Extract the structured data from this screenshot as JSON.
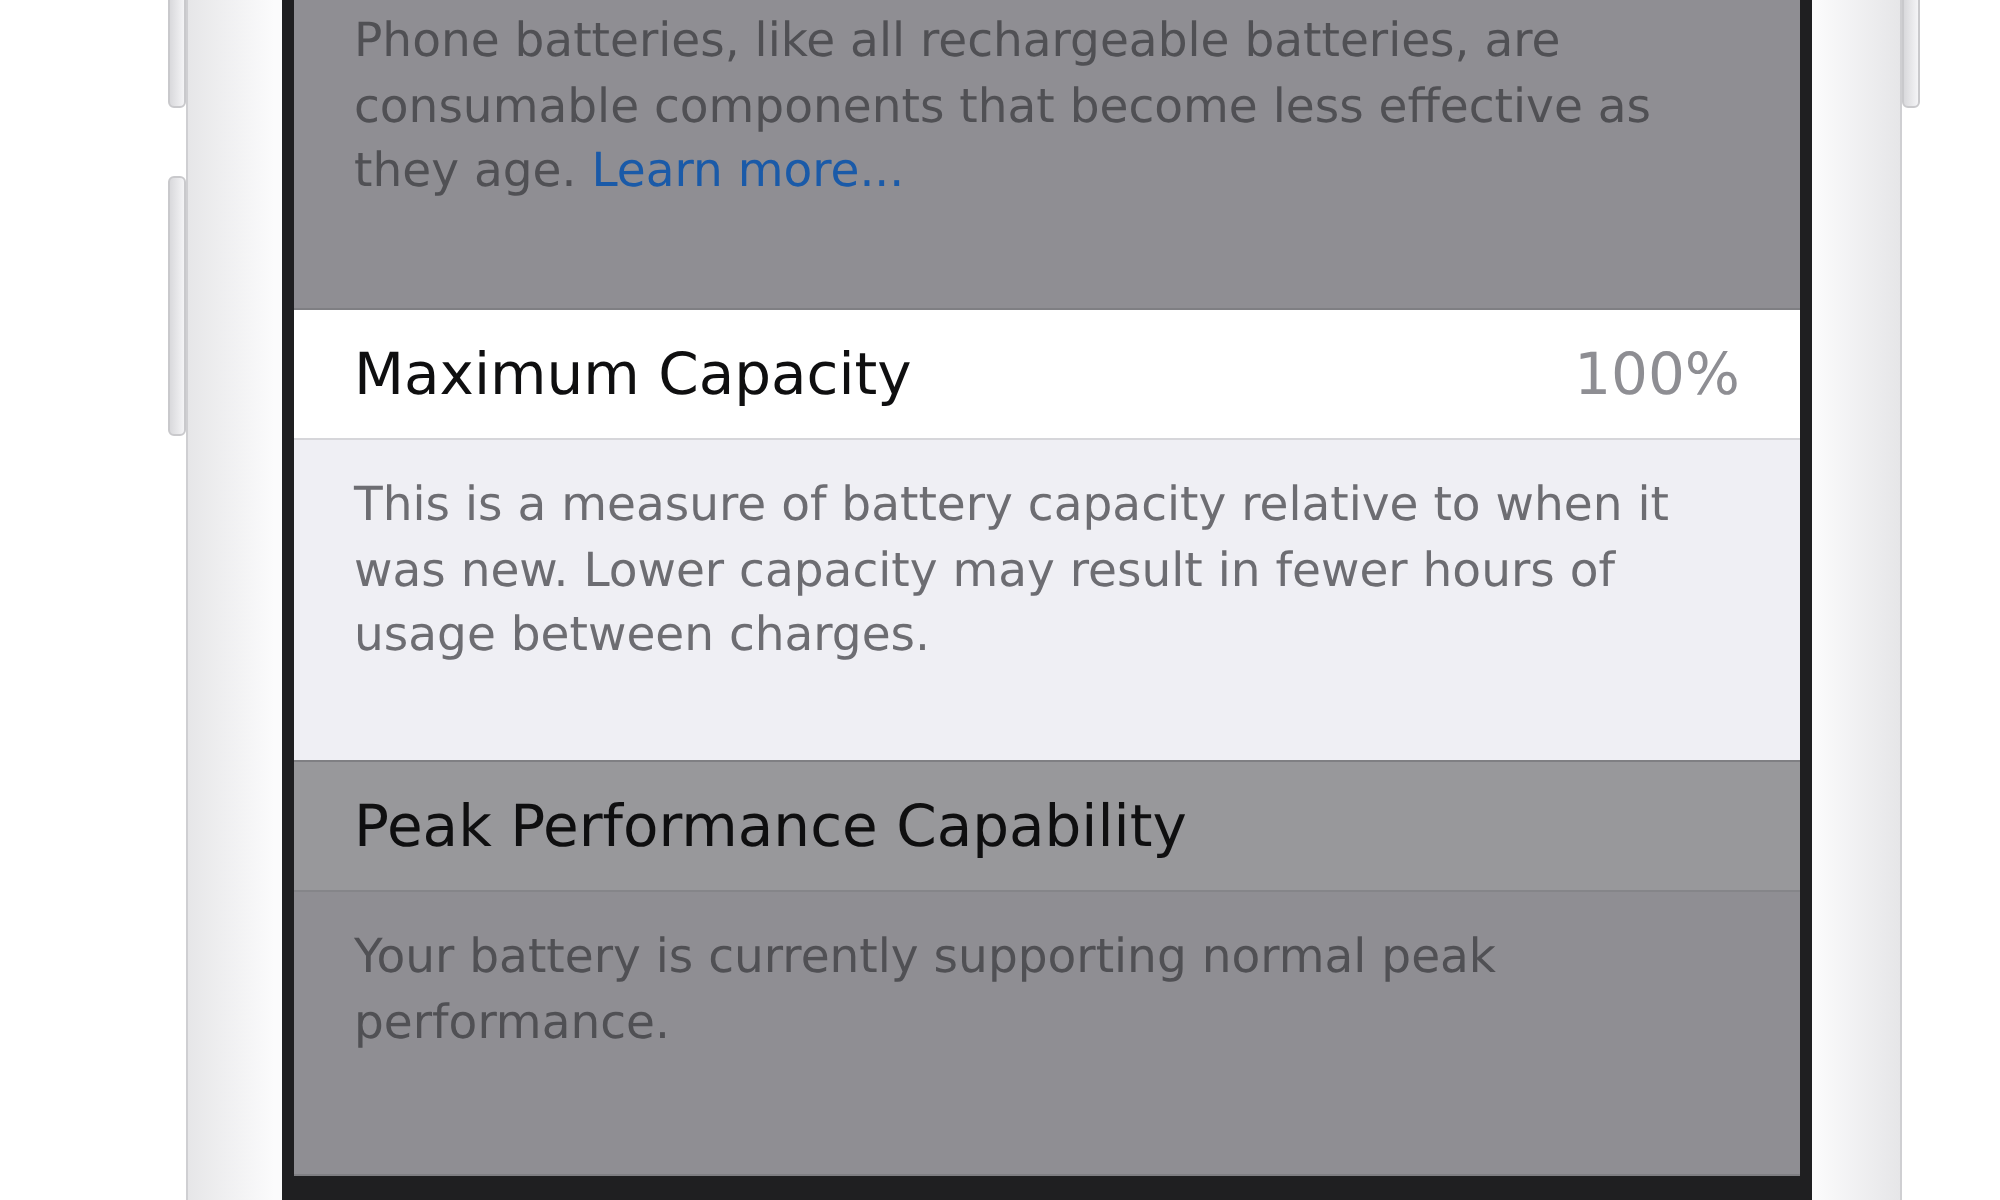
{
  "sections": [
    {
      "highlighted": false,
      "footer": "Phone batteries, like all rechargeable batteries, are consumable components that become less effective as they age.",
      "link": "Learn more..."
    },
    {
      "highlighted": true,
      "title": "Maximum Capacity",
      "value": "100%",
      "footer": "This is a measure of battery capacity relative to when it was new. Lower capacity may result in fewer hours of usage between charges."
    },
    {
      "highlighted": false,
      "title": "Peak Performance Capability",
      "footer": "Your battery is currently supporting normal peak performance."
    }
  ]
}
